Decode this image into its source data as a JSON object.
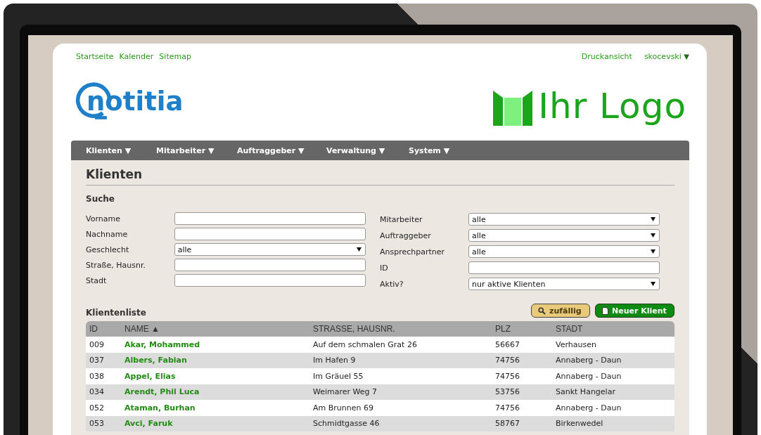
{
  "top_links": [
    {
      "label": "Startseite"
    },
    {
      "label": "Kalender"
    },
    {
      "label": "Sitemap"
    }
  ],
  "print_link": {
    "label": "Druckansicht"
  },
  "user_menu": {
    "label": "skocevski",
    "caret": "▼"
  },
  "logo": {
    "text": "notitia"
  },
  "customer_logo": {
    "text": "Ihr Logo"
  },
  "nav": [
    {
      "label": "Klienten ▼"
    },
    {
      "label": "Mitarbeiter ▼"
    },
    {
      "label": "Auftraggeber ▼"
    },
    {
      "label": "Verwaltung ▼"
    },
    {
      "label": "System ▼"
    }
  ],
  "page_title": "Klienten",
  "search": {
    "title": "Suche",
    "left_fields": [
      {
        "label": "Vorname",
        "kind": "text"
      },
      {
        "label": "Nachname",
        "kind": "text"
      },
      {
        "label": "Geschlecht",
        "kind": "select",
        "value": "alle"
      },
      {
        "label": "Straße, Hausnr.",
        "kind": "text"
      },
      {
        "label": "Stadt",
        "kind": "text"
      }
    ],
    "right_fields": [
      {
        "label": "Mitarbeiter",
        "kind": "select",
        "value": "alle"
      },
      {
        "label": "Auftraggeber",
        "kind": "select",
        "value": "alle"
      },
      {
        "label": "Ansprechpartner",
        "kind": "select",
        "value": "alle"
      },
      {
        "label": "ID",
        "kind": "text"
      },
      {
        "label": "Aktiv?",
        "kind": "select",
        "value": "nur aktive Klienten"
      }
    ]
  },
  "list": {
    "title": "Klientenliste",
    "buttons": [
      {
        "label": "zufällig",
        "kind": "random"
      },
      {
        "label": "Neuer Klient",
        "kind": "new"
      }
    ],
    "columns": [
      "ID",
      "NAME ▲",
      "STRASSE, HAUSNR.",
      "PLZ",
      "STADT"
    ],
    "rows": [
      [
        "009",
        "Akar, Mohammed",
        "Auf dem schmalen Grat 26",
        "56667",
        "Verhausen"
      ],
      [
        "037",
        "Albers, Fabian",
        "Im Hafen 9",
        "74756",
        "Annaberg - Daun"
      ],
      [
        "038",
        "Appel, Elias",
        "Im Gräuel 55",
        "74756",
        "Annaberg - Daun"
      ],
      [
        "034",
        "Arendt, Phil Luca",
        "Weimarer Weg 7",
        "53756",
        "Sankt Hangelar"
      ],
      [
        "052",
        "Ataman, Burhan",
        "Am Brunnen 69",
        "74756",
        "Annaberg - Daun"
      ],
      [
        "053",
        "Avci, Faruk",
        "Schmidtgasse 46",
        "58767",
        "Birkenwedel"
      ]
    ]
  }
}
